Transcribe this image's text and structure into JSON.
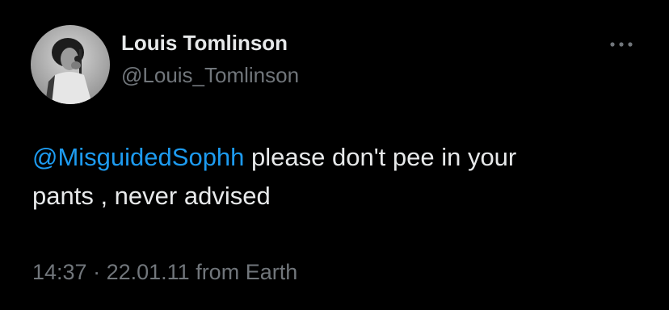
{
  "author": {
    "display_name": "Louis Tomlinson",
    "handle": "@Louis_Tomlinson",
    "avatar_icon": "profile-photo"
  },
  "header": {
    "more_icon": "ellipsis-icon"
  },
  "tweet": {
    "mention": "@MisguidedSophh",
    "text_line1_rest": " please don't pee in your",
    "text_line2": "pants , never advised"
  },
  "meta": {
    "time": "14:37",
    "separator": " · ",
    "date": "22.01.11",
    "source": " from Earth"
  },
  "colors": {
    "background": "#000000",
    "primary_text": "#e7e9ea",
    "secondary_text": "#71767b",
    "mention": "#1d9bf0"
  }
}
